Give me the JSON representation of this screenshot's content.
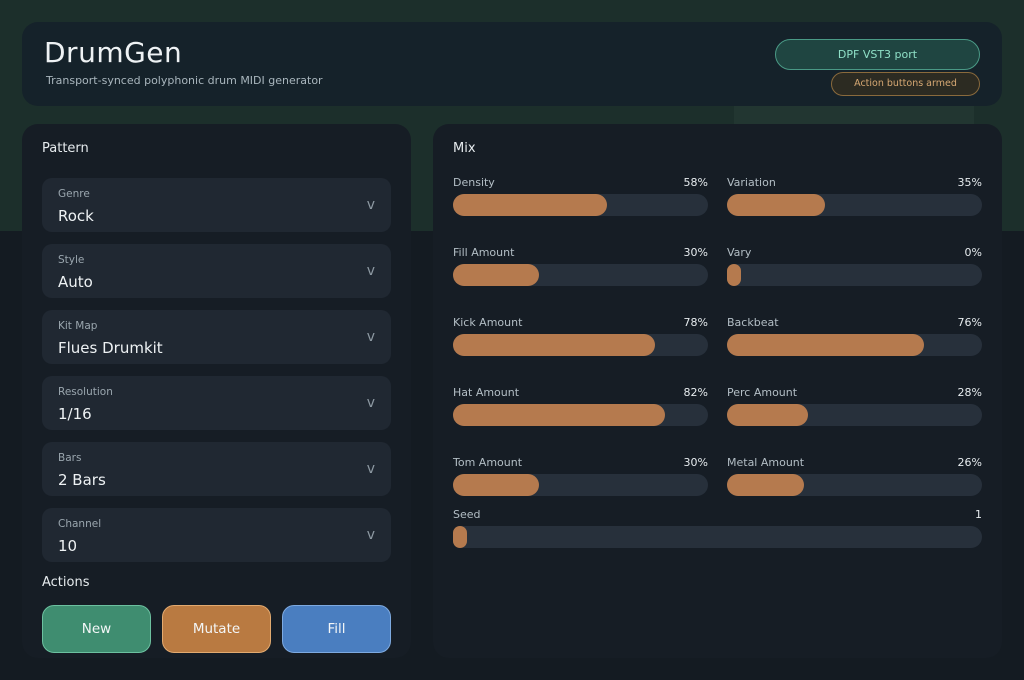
{
  "header": {
    "title": "DrumGen",
    "subtitle": "Transport-synced polyphonic drum MIDI generator",
    "badge_port": "DPF VST3 port",
    "badge_armed": "Action buttons armed"
  },
  "pattern": {
    "title": "Pattern",
    "selects": [
      {
        "label": "Genre",
        "value": "Rock"
      },
      {
        "label": "Style",
        "value": "Auto"
      },
      {
        "label": "Kit Map",
        "value": "Flues Drumkit"
      },
      {
        "label": "Resolution",
        "value": "1/16"
      },
      {
        "label": "Bars",
        "value": "2 Bars"
      },
      {
        "label": "Channel",
        "value": "10"
      }
    ],
    "chevron": "v",
    "actions_title": "Actions",
    "actions": {
      "new": "New",
      "mutate": "Mutate",
      "fill": "Fill"
    }
  },
  "mix": {
    "title": "Mix",
    "sliders": [
      {
        "label": "Density",
        "value": "58%",
        "fraction": 0.58
      },
      {
        "label": "Variation",
        "value": "35%",
        "fraction": 0.35
      },
      {
        "label": "Fill Amount",
        "value": "30%",
        "fraction": 0.3
      },
      {
        "label": "Vary",
        "value": "0%",
        "fraction": 0.0
      },
      {
        "label": "Kick Amount",
        "value": "78%",
        "fraction": 0.78
      },
      {
        "label": "Backbeat",
        "value": "76%",
        "fraction": 0.76
      },
      {
        "label": "Hat Amount",
        "value": "82%",
        "fraction": 0.82
      },
      {
        "label": "Perc Amount",
        "value": "28%",
        "fraction": 0.28
      },
      {
        "label": "Tom Amount",
        "value": "30%",
        "fraction": 0.3
      },
      {
        "label": "Metal Amount",
        "value": "26%",
        "fraction": 0.26
      }
    ],
    "seed": {
      "label": "Seed",
      "value": "1",
      "fraction": 0.0
    }
  },
  "colors": {
    "accent_fill": "#b57a4e",
    "new_button": "#3f8d70",
    "mutate_button": "#b97a41",
    "fill_button": "#4a7ec0"
  }
}
